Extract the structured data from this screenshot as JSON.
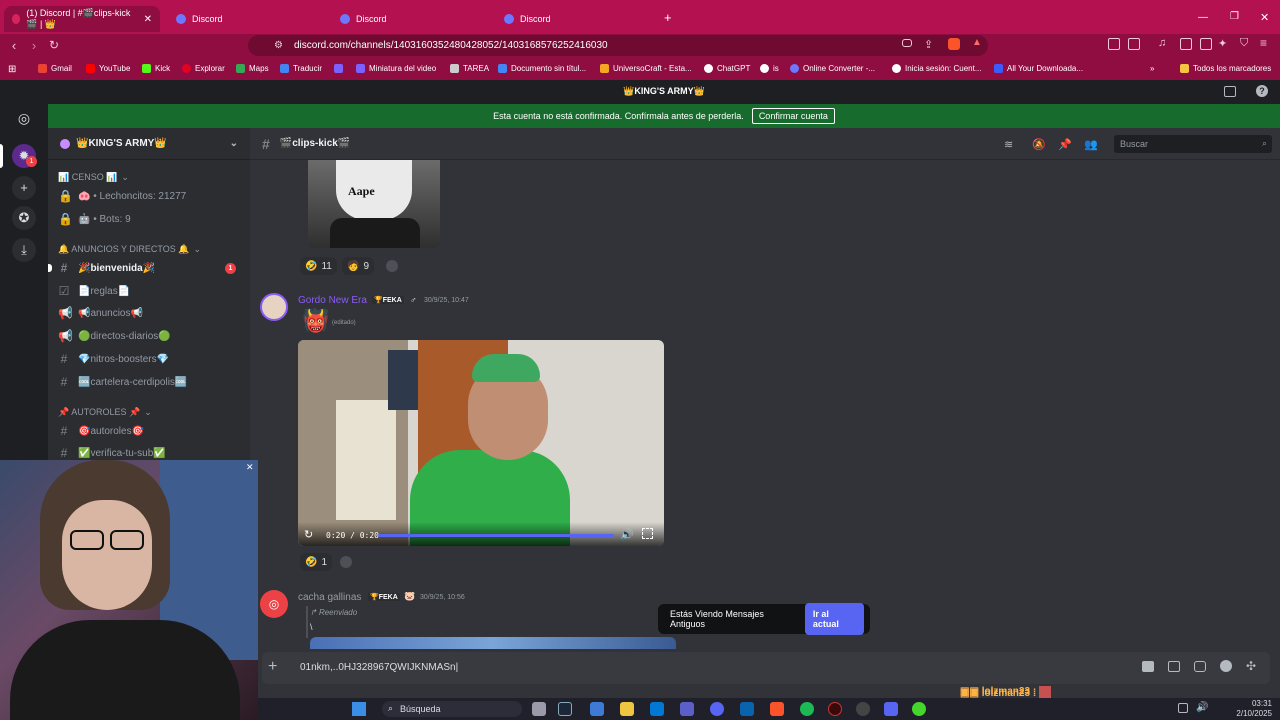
{
  "browser": {
    "tabs": [
      {
        "label": "(1) Discord | #🎬clips-kick🎬 | 👑",
        "active": true
      },
      {
        "label": "Discord",
        "active": false
      },
      {
        "label": "Discord",
        "active": false
      },
      {
        "label": "Discord",
        "active": false
      }
    ],
    "new_tab_label": "+",
    "url": "discord.com/channels/1403160352480428052/1403168576252416030",
    "bookmarks": [
      "Gmail",
      "YouTube",
      "Kick",
      "Explorar",
      "Maps",
      "Traducir",
      "Miniatura del video",
      "TAREA",
      "Documento sin títul...",
      "UniversoCraft - Esta...",
      "ChatGPT",
      "is",
      "Online Converter -...",
      "Inicia sesión: Cuent...",
      "All Your Downloada..."
    ],
    "bookmarks_folder": "Todos los marcadores",
    "accent_color": "#b3114f"
  },
  "discord": {
    "server_title_bar": "👑KING'S ARMY👑",
    "notice": {
      "text": "Esta cuenta no está confirmada. Confírmala antes de perderla.",
      "button": "Confirmar cuenta"
    },
    "guild_badge": "1",
    "server_name": "👑KING'S ARMY👑",
    "categories": [
      {
        "name": "📊 CENSO 📊",
        "channels": [
          "🐽 • Lechoncitos: 21277",
          "🤖 • Bots: 9"
        ]
      },
      {
        "name": "🔔 ANUNCIOS Y DIRECTOS 🔔",
        "channels": [
          "🎉bienvenida🎉",
          "📄reglas📄",
          "📢anuncios📢",
          "🟢directos-diarios🟢",
          "💎nitros-boosters💎",
          "🆒cartelera-cerdipolis🆒"
        ]
      },
      {
        "name": "📌 AUTOROLES 📌",
        "channels": [
          "🎯autoroles🎯",
          "✅verifica-tu-sub✅"
        ]
      }
    ],
    "unread_badge": "1",
    "channel_name": "🎬clips-kick🎬",
    "search_placeholder": "Buscar",
    "messages": [
      {
        "reactions": [
          {
            "emoji": "🤣",
            "count": "11"
          },
          {
            "emoji": "🧑",
            "count": "9"
          }
        ]
      },
      {
        "author": "Gordo New Era",
        "tag": "FEKA",
        "timestamp": "30/9/25, 10:47",
        "content": "👹",
        "edited": "(editado)",
        "video_time": "0:20 / 0:20",
        "reactions": [
          {
            "emoji": "🤣",
            "count": "1"
          }
        ]
      },
      {
        "author": "cacha gallinas",
        "tag": "FEKA",
        "timestamp": "30/9/25, 10:56",
        "forwarded": "Reenviado",
        "content": "\\"
      }
    ],
    "jump_pill": {
      "text": "Estás Viendo Mensajes Antiguos",
      "button": "Ir al actual"
    },
    "composer_value": "01nkm,..0HJ328967QWIJKNMASn|"
  },
  "taskbar": {
    "search_label": "Búsqueda",
    "time": "03:31",
    "date": "2/10/2025"
  },
  "overlay_chat": [
    {
      "user": "lolzman23 :"
    },
    {
      "user": "lolzman23 :"
    }
  ]
}
